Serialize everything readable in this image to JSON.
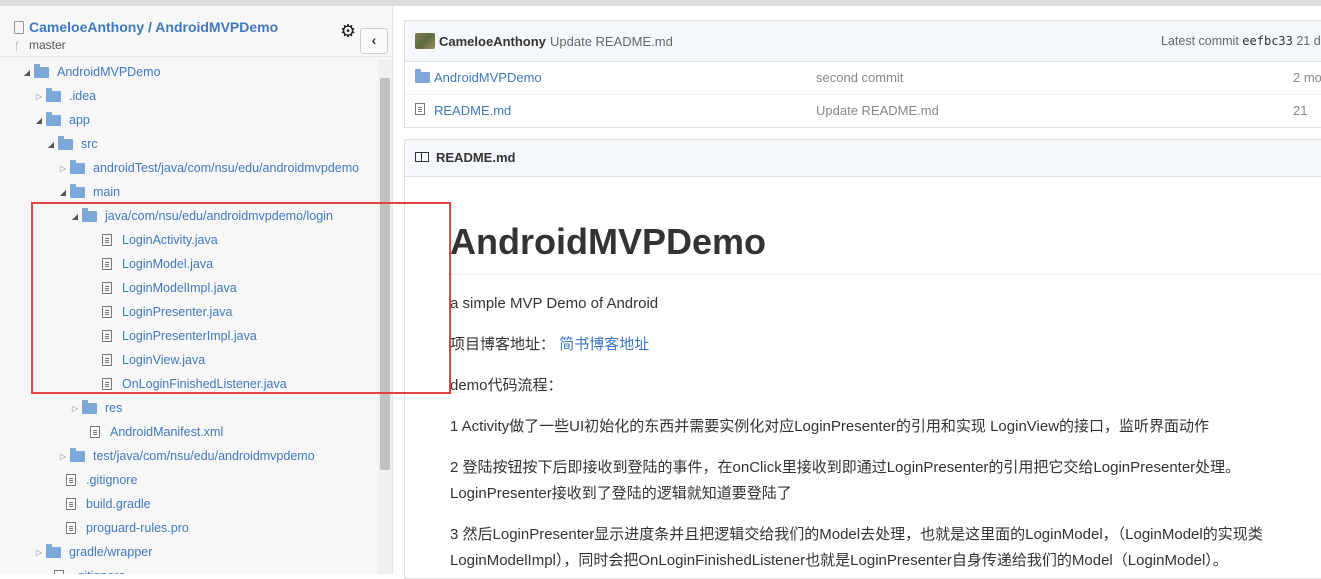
{
  "repo": {
    "owner": "CameloeAnthony",
    "separator": " / ",
    "name": "AndroidMVPDemo",
    "branch": "master"
  },
  "tree": [
    {
      "label": "AndroidMVPDemo",
      "type": "folder",
      "open": true,
      "indent": 0
    },
    {
      "label": ".idea",
      "type": "folder",
      "open": false,
      "indent": 1
    },
    {
      "label": "app",
      "type": "folder",
      "open": true,
      "indent": 1
    },
    {
      "label": "src",
      "type": "folder",
      "open": true,
      "indent": 2
    },
    {
      "label": "androidTest/java/com/nsu/edu/androidmvpdemo",
      "type": "folder",
      "open": false,
      "indent": 3
    },
    {
      "label": "main",
      "type": "folder",
      "open": true,
      "indent": 3
    },
    {
      "label": "java/com/nsu/edu/androidmvpdemo/login",
      "type": "folder",
      "open": true,
      "indent": 4
    },
    {
      "label": "LoginActivity.java",
      "type": "file",
      "indent": 5
    },
    {
      "label": "LoginModel.java",
      "type": "file",
      "indent": 5
    },
    {
      "label": "LoginModelImpl.java",
      "type": "file",
      "indent": 5
    },
    {
      "label": "LoginPresenter.java",
      "type": "file",
      "indent": 5
    },
    {
      "label": "LoginPresenterImpl.java",
      "type": "file",
      "indent": 5
    },
    {
      "label": "LoginView.java",
      "type": "file",
      "indent": 5
    },
    {
      "label": "OnLoginFinishedListener.java",
      "type": "file",
      "indent": 5
    },
    {
      "label": "res",
      "type": "folder",
      "open": false,
      "indent": 4
    },
    {
      "label": "AndroidManifest.xml",
      "type": "file",
      "indent": 4
    },
    {
      "label": "test/java/com/nsu/edu/androidmvpdemo",
      "type": "folder",
      "open": false,
      "indent": 3
    },
    {
      "label": ".gitignore",
      "type": "file",
      "indent": 2
    },
    {
      "label": "build.gradle",
      "type": "file",
      "indent": 2
    },
    {
      "label": "proguard-rules.pro",
      "type": "file",
      "indent": 2
    },
    {
      "label": "gradle/wrapper",
      "type": "folder",
      "open": false,
      "indent": 1
    },
    {
      "label": ".gitignore",
      "type": "file",
      "indent": 1
    }
  ],
  "commit": {
    "author": "CameloeAnthony",
    "message": "Update README.md",
    "latest_label": "Latest commit",
    "sha": "eefbc33",
    "age": "21 d"
  },
  "files": [
    {
      "name": "AndroidMVPDemo",
      "type": "folder",
      "message": "second commit",
      "age": "2 mo"
    },
    {
      "name": "README.md",
      "type": "file",
      "message": "Update README.md",
      "age": "21"
    }
  ],
  "readme": {
    "header": "README.md",
    "h1": "AndroidMVPDemo",
    "p1": "a simple MVP Demo of Android",
    "p2_prefix": "项目博客地址：",
    "p2_link": "简书博客地址",
    "p3": "demo代码流程：",
    "p4": "1 Activity做了一些UI初始化的东西并需要实例化对应LoginPresenter的引用和实现 LoginView的接口，监听界面动作",
    "p5a": "2 登陆按钮按下后即接收到登陆的事件，在onClick里接收到即通过LoginPresenter的引用把它交给LoginPresenter处理。",
    "p5b": "LoginPresenter接收到了登陆的逻辑就知道要登陆了",
    "p6a": "3 然后LoginPresenter显示进度条并且把逻辑交给我们的Model去处理，也就是这里面的LoginModel，（LoginModel的实现类",
    "p6b": "LoginModelImpl），同时会把OnLoginFinishedListener也就是LoginPresenter自身传递给我们的Model（LoginModel）。"
  },
  "colors": {
    "link": "#4078c0",
    "highlight": "#e24242",
    "folder": "#7da7d9"
  },
  "icons": {
    "settings": "gear-icon",
    "collapse": "chevron-left-icon",
    "folder": "folder-icon",
    "file": "file-icon",
    "readme": "book-icon"
  }
}
